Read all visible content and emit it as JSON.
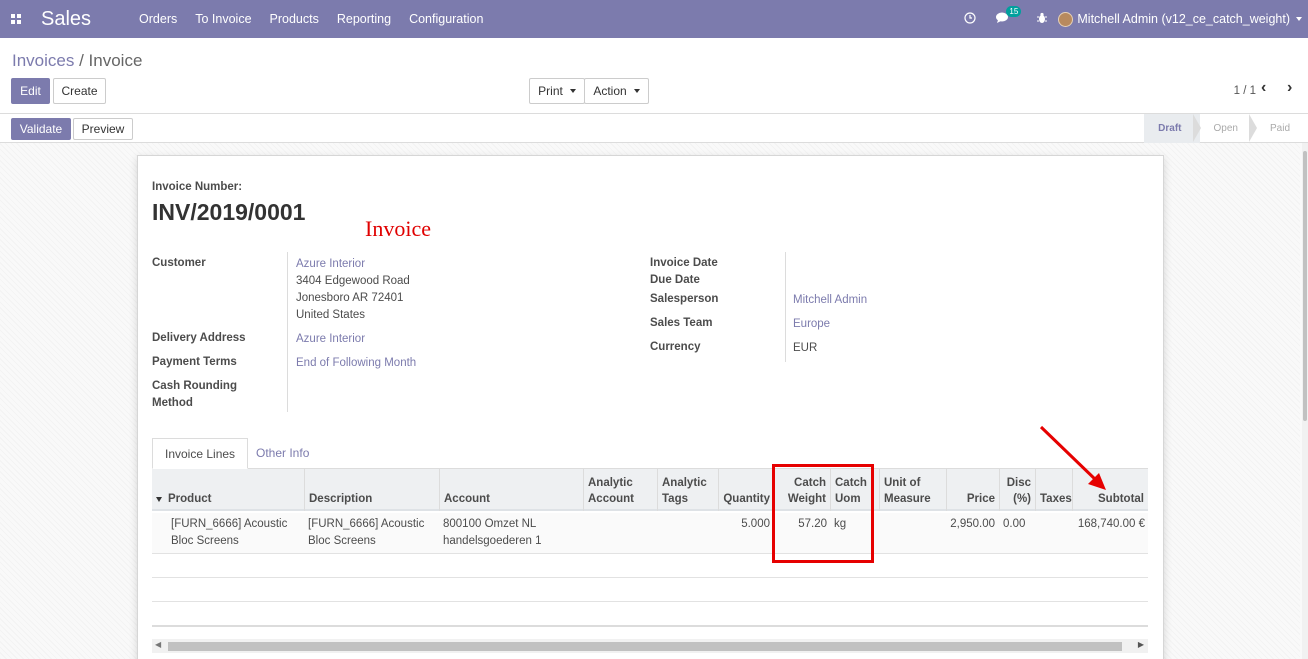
{
  "navbar": {
    "brand": "Sales",
    "menu": [
      "Orders",
      "To Invoice",
      "Products",
      "Reporting",
      "Configuration"
    ],
    "chat_count": "15",
    "user": "Mitchell Admin (v12_ce_catch_weight)"
  },
  "breadcrumb": {
    "parent": "Invoices",
    "separator": " / ",
    "current": "Invoice"
  },
  "buttons": {
    "edit": "Edit",
    "create": "Create",
    "print": "Print",
    "action": "Action",
    "validate": "Validate",
    "preview": "Preview"
  },
  "pager": {
    "value": "1 / 1",
    "prev": "‹",
    "next": "›"
  },
  "states": [
    "Draft",
    "Open",
    "Paid"
  ],
  "invoice": {
    "number_label": "Invoice Number:",
    "number": "INV/2019/0001",
    "annotation": "Invoice",
    "customer_label": "Customer",
    "customer_name": "Azure Interior",
    "customer_address": [
      "3404 Edgewood Road",
      "Jonesboro AR 72401",
      "United States"
    ],
    "delivery_label": "Delivery Address",
    "delivery_value": "Azure Interior",
    "payment_terms_label": "Payment Terms",
    "payment_terms_value": "End of Following Month",
    "cash_rounding_label": "Cash Rounding Method",
    "invoice_date_label": "Invoice Date",
    "due_date_label": "Due Date",
    "salesperson_label": "Salesperson",
    "salesperson_value": "Mitchell Admin",
    "sales_team_label": "Sales Team",
    "sales_team_value": "Europe",
    "currency_label": "Currency",
    "currency_value": "EUR"
  },
  "tabs": [
    "Invoice Lines",
    "Other Info"
  ],
  "table": {
    "headers": {
      "product": "Product",
      "description": "Description",
      "account": "Account",
      "analytic_account": "Analytic Account",
      "analytic_tags": "Analytic Tags",
      "quantity": "Quantity",
      "catch_weight": "Catch Weight",
      "catch_uom": "Catch Uom",
      "uom": "Unit of Measure",
      "price": "Price",
      "disc": "Disc (%)",
      "taxes": "Taxes",
      "subtotal": "Subtotal"
    },
    "rows": [
      {
        "product": "[FURN_6666] Acoustic Bloc Screens",
        "description": "[FURN_6666] Acoustic Bloc Screens",
        "account": "800100 Omzet NL handelsgoederen 1",
        "analytic_account": "",
        "analytic_tags": "",
        "quantity": "5.000",
        "catch_weight": "57.20",
        "catch_uom": "kg",
        "uom": "",
        "price": "2,950.00",
        "disc": "0.00",
        "taxes": "",
        "subtotal": "168,740.00 €"
      }
    ]
  },
  "colors": {
    "brand": "#7c7bad",
    "annotation_red": "#e60000"
  }
}
